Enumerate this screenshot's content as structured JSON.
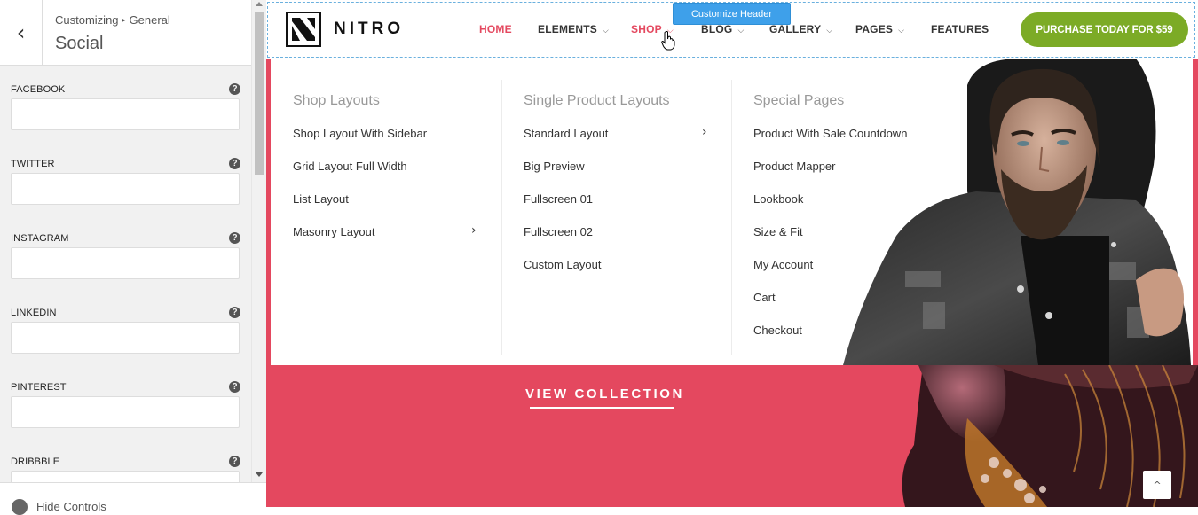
{
  "sidebar": {
    "back_glyph": "‹",
    "breadcrumb": [
      "Customizing",
      "General"
    ],
    "breadcrumb_sep": "▸",
    "section_title": "Social",
    "fields": [
      {
        "label": "FACEBOOK",
        "value": ""
      },
      {
        "label": "TWITTER",
        "value": ""
      },
      {
        "label": "INSTAGRAM",
        "value": ""
      },
      {
        "label": "LINKEDIN",
        "value": ""
      },
      {
        "label": "PINTEREST",
        "value": ""
      },
      {
        "label": "DRIBBBLE",
        "value": ""
      }
    ],
    "help_glyph": "?",
    "footer_label": "Hide Controls"
  },
  "preview": {
    "customize_badge": "Customize Header",
    "brand": "NITRO",
    "nav": [
      {
        "label": "HOME",
        "active": true,
        "dropdown": false
      },
      {
        "label": "ELEMENTS",
        "dropdown": true
      },
      {
        "label": "SHOP",
        "active": true,
        "dropdown": true
      },
      {
        "label": "BLOG",
        "dropdown": true
      },
      {
        "label": "GALLERY",
        "dropdown": true
      },
      {
        "label": "PAGES",
        "dropdown": true
      },
      {
        "label": "FEATURES",
        "dropdown": false
      }
    ],
    "purchase_button": "PURCHASE TODAY FOR $59",
    "mega_menu": [
      {
        "title": "Shop Layouts",
        "links": [
          {
            "label": "Shop Layout With Sidebar"
          },
          {
            "label": "Grid Layout Full Width"
          },
          {
            "label": "List Layout"
          },
          {
            "label": "Masonry Layout",
            "submenu": true
          }
        ]
      },
      {
        "title": "Single Product Layouts",
        "links": [
          {
            "label": "Standard Layout",
            "submenu": true
          },
          {
            "label": "Big Preview"
          },
          {
            "label": "Fullscreen 01"
          },
          {
            "label": "Fullscreen 02"
          },
          {
            "label": "Custom Layout"
          }
        ]
      },
      {
        "title": "Special Pages",
        "links": [
          {
            "label": "Product With Sale Countdown"
          },
          {
            "label": "Product Mapper"
          },
          {
            "label": "Lookbook"
          },
          {
            "label": "Size & Fit"
          },
          {
            "label": "My Account"
          },
          {
            "label": "Cart"
          },
          {
            "label": "Checkout"
          }
        ]
      }
    ],
    "submenu_glyph": "›",
    "view_collection": "VIEW COLLECTION",
    "scroll_top_glyph": "^",
    "colors": {
      "accent": "#e4485f",
      "purchase": "#7cab26",
      "badge": "#3ea0ea"
    }
  }
}
